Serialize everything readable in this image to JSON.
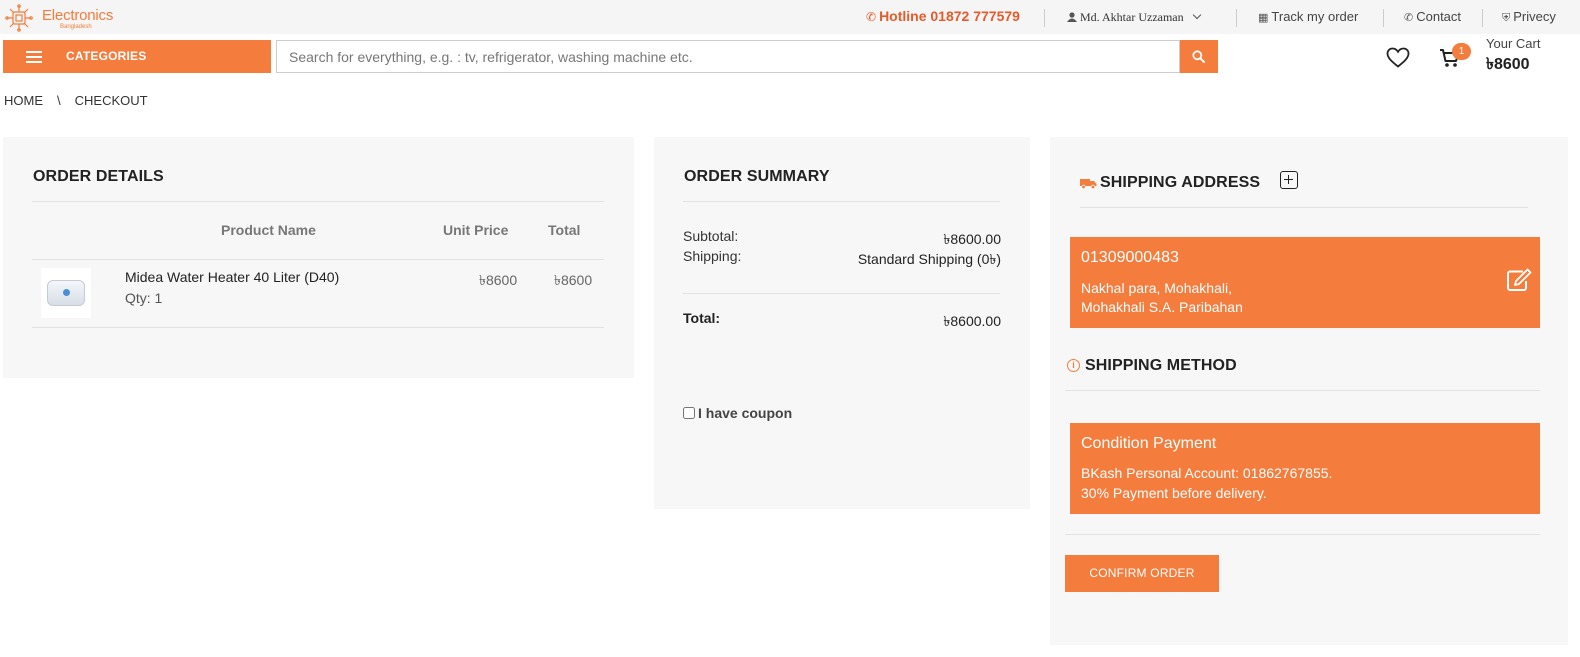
{
  "brand": {
    "name": "Electronics",
    "tagline": "Bangladesh"
  },
  "topbar": {
    "hotline": "Hotline 01872 777579",
    "user": "Md. Akhtar Uzzaman",
    "links": {
      "track": "Track my order",
      "contact": "Contact",
      "privacy": "Privecy"
    }
  },
  "header": {
    "categories_label": "CATEGORIES",
    "search_placeholder": "Search for everything, e.g. : tv, refrigerator, washing machine etc.",
    "cart_count": "1",
    "cart_label": "Your Cart",
    "cart_total": "৳8600"
  },
  "breadcrumb": {
    "home": "HOME",
    "separator": "\\",
    "current": "CHECKOUT"
  },
  "order_details": {
    "title": "ORDER DETAILS",
    "columns": {
      "name": "Product Name",
      "unit": "Unit Price",
      "total": "Total"
    },
    "item": {
      "name": "Midea Water Heater 40 Liter (D40)",
      "qty": "Qty: 1",
      "unit_price": "৳8600",
      "total": "৳8600"
    }
  },
  "order_summary": {
    "title": "ORDER SUMMARY",
    "subtotal_label": "Subtotal:",
    "subtotal_value": "৳8600.00",
    "shipping_label": "Shipping:",
    "shipping_value": "Standard Shipping (0৳)",
    "total_label": "Total:",
    "total_value": "৳8600.00",
    "coupon_label": "I have coupon"
  },
  "shipping": {
    "title": "SHIPPING ADDRESS",
    "address": {
      "phone": "01309000483",
      "line1": "Nakhal para, Mohakhali,",
      "line2": "Mohakhali S.A. Paribahan"
    },
    "method_title": "SHIPPING METHOD",
    "payment": {
      "title": "Condition Payment",
      "line1": "BKash Personal Account: 01862767855.",
      "line2": "30% Payment before delivery."
    },
    "confirm_label": "CONFIRM ORDER"
  },
  "colors": {
    "accent": "#f47c3c",
    "panel": "#f7f7f7",
    "topbar": "#f5f5f5"
  }
}
